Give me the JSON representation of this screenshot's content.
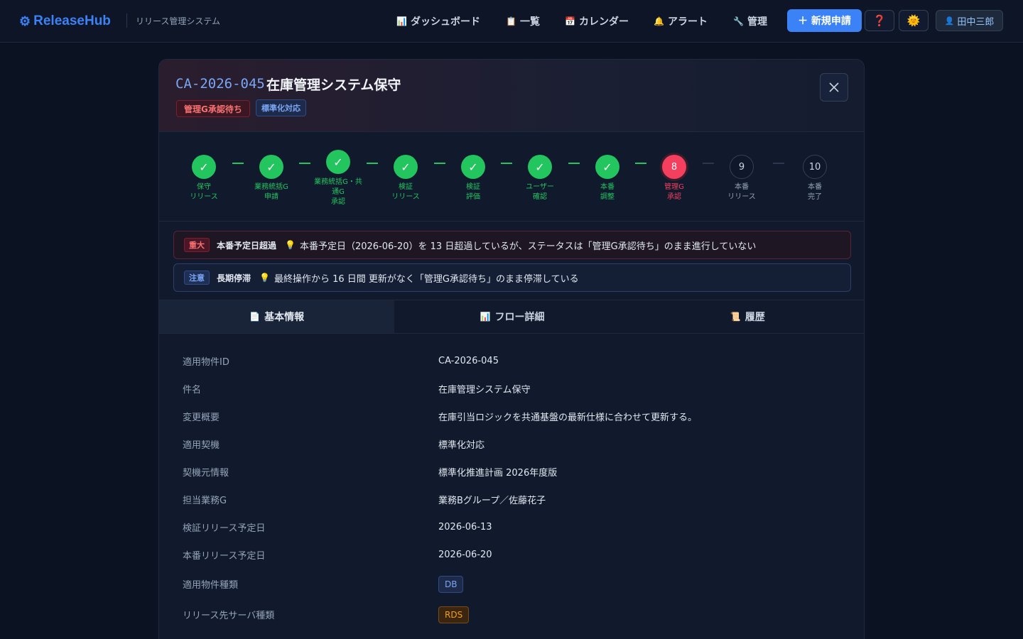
{
  "app": {
    "name": "ReleaseHub",
    "subtitle": "リリース管理システム"
  },
  "nav": [
    {
      "icon": "📊",
      "label": "ダッシュボード"
    },
    {
      "icon": "📋",
      "label": "一覧"
    },
    {
      "icon": "📅",
      "label": "カレンダー"
    },
    {
      "icon": "🔔",
      "label": "アラート"
    },
    {
      "icon": "🔧",
      "label": "管理"
    }
  ],
  "actions": {
    "new_label": "＋ 新規申請",
    "help_icon": "❓",
    "theme_icon": "🌞"
  },
  "user": {
    "icon": "👤",
    "name": "田中三郎"
  },
  "modal": {
    "id": "CA-2026-045",
    "title": "在庫管理システム保守",
    "status_badge": "管理G承認待ち",
    "type_badge": "標準化対応",
    "close_icon": "✕"
  },
  "steps": [
    {
      "mark": "✓",
      "label": "保守\nリリース",
      "state": "done"
    },
    {
      "mark": "✓",
      "label": "業務統括G\n申請",
      "state": "done"
    },
    {
      "mark": "✓",
      "label": "業務統括G・共\n通G\n承認",
      "state": "done"
    },
    {
      "mark": "✓",
      "label": "検証\nリリース",
      "state": "done"
    },
    {
      "mark": "✓",
      "label": "検証\n評価",
      "state": "done"
    },
    {
      "mark": "✓",
      "label": "ユーザー\n確認",
      "state": "done"
    },
    {
      "mark": "✓",
      "label": "本番\n調整",
      "state": "done"
    },
    {
      "mark": "8",
      "label": "管理G\n承認",
      "state": "current"
    },
    {
      "mark": "9",
      "label": "本番\nリリース",
      "state": "pending"
    },
    {
      "mark": "10",
      "label": "本番\n完了",
      "state": "pending"
    }
  ],
  "alerts": [
    {
      "tag": "重大",
      "title": "本番予定日超過",
      "icon": "💡",
      "message": "本番予定日（2026-06-20）を 13 日超過しているが、ステータスは「管理G承認待ち」のまま進行していない"
    },
    {
      "tag": "注意",
      "title": "長期停滞",
      "icon": "💡",
      "message": "最終操作から 16 日間 更新がなく「管理G承認待ち」のまま停滞している"
    }
  ],
  "tabs": [
    {
      "icon": "📄",
      "label": "基本情報"
    },
    {
      "icon": "📊",
      "label": "フロー詳細"
    },
    {
      "icon": "📜",
      "label": "履歴"
    }
  ],
  "info": [
    {
      "key": "適用物件ID",
      "value": "CA-2026-045"
    },
    {
      "key": "件名",
      "value": "在庫管理システム保守"
    },
    {
      "key": "変更概要",
      "value": "在庫引当ロジックを共通基盤の最新仕様に合わせて更新する。"
    },
    {
      "key": "適用契機",
      "value": "標準化対応"
    },
    {
      "key": "契機元情報",
      "value": "標準化推進計画 2026年度版"
    },
    {
      "key": "担当業務G",
      "value": "業務Bグループ／佐藤花子"
    },
    {
      "key": "検証リリース予定日",
      "value": "2026-06-13"
    },
    {
      "key": "本番リリース予定日",
      "value": "2026-06-20"
    },
    {
      "key": "適用物件種類",
      "value": "DB"
    },
    {
      "key": "リリース先サーバ種類",
      "value": "RDS"
    }
  ]
}
